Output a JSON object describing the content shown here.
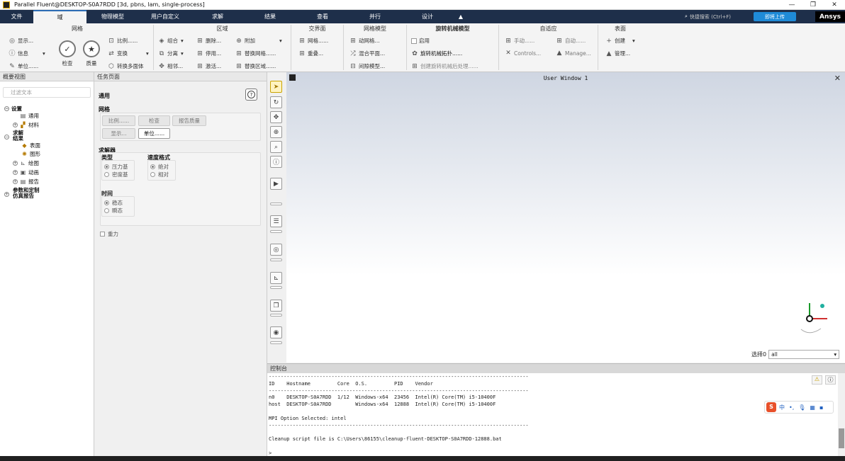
{
  "titlebar": {
    "title": "Parallel Fluent@DESKTOP-S0A7RDD  [3d, pbns, lam, single-process]",
    "min": "—",
    "restore": "❐",
    "close": "✕"
  },
  "menu": {
    "items": [
      "文件",
      "域",
      "物理模型",
      "用户自定义",
      "求解",
      "结果",
      "查看",
      "并行",
      "设计",
      "▲"
    ],
    "search": "快捷搜索 (Ctrl+F)",
    "upload": "即将上传",
    "brand": "Ansys"
  },
  "ribbon": {
    "mesh": {
      "title": "网格",
      "display": "显示...",
      "info": "信息",
      "units": "单位......",
      "scale": "比例......",
      "transform": "变换",
      "poly": "转换多面体",
      "check": "检查",
      "quality": "质量"
    },
    "zones": {
      "title": "区域",
      "combine": "组合",
      "separate": "分离",
      "adjacency": "相邻...",
      "delete": "删除...",
      "deactivate": "停用...",
      "activate": "激活...",
      "append": "附加",
      "replace_mesh": "替换网格......",
      "replace_zone": "替换区域......"
    },
    "interfaces": {
      "title": "交界面",
      "mesh": "网格......",
      "overset": "重叠..."
    },
    "mesh_models": {
      "title": "网格模型",
      "dynamic": "动网格...",
      "mixing": "混合平面...",
      "adaption": "间隙模型..."
    },
    "turbo": {
      "title": "旋转机械模型",
      "enable": "启用",
      "topology": "旋转机械拓扑......",
      "post": "创建旋转机械后处理......"
    },
    "adapt": {
      "title": "自适应",
      "manual": "手动......",
      "auto": "自动......",
      "controls": "Controls...",
      "manage": "Manage..."
    },
    "surface": {
      "title": "表面",
      "create": "创建",
      "manage": "管理..."
    }
  },
  "tree": {
    "title": "概要视图",
    "filter_placeholder": "过滤文本",
    "items": [
      {
        "label": "设置",
        "bold": true
      },
      {
        "label": "通用"
      },
      {
        "label": "材料"
      },
      {
        "label": "求解",
        "bold": true
      },
      {
        "label": "结果",
        "bold": true
      },
      {
        "label": "表面"
      },
      {
        "label": "图形"
      },
      {
        "label": "绘图"
      },
      {
        "label": "动画"
      },
      {
        "label": "报告"
      },
      {
        "label": "参数和定制",
        "bold": true
      },
      {
        "label": "仿真报告",
        "bold": true
      }
    ]
  },
  "task": {
    "title": "任务页面",
    "heading": "通用",
    "help": "?",
    "mesh_label": "网格",
    "mesh_buttons": {
      "scale": "比例......",
      "check": "检查",
      "report_quality": "报告质量",
      "display": "显示...",
      "units": "单位......"
    },
    "solver_label": "求解器",
    "type_label": "类型",
    "type_options": [
      "压力基",
      "密度基"
    ],
    "velocity_label": "速度格式",
    "velocity_options": [
      "绝对",
      "相对"
    ],
    "time_label": "时间",
    "time_options": [
      "稳态",
      "瞬态"
    ],
    "gravity": "重力"
  },
  "viewer": {
    "title": "User Window 1",
    "close": "✕",
    "select_label": "选择0",
    "select_value": "all"
  },
  "console": {
    "title": "控制台",
    "text": "---------------------------------------------------------------------------------------\nID    Hostname         Core  O.S.         PID    Vendor\n---------------------------------------------------------------------------------------\nn0    DESKTOP-S0A7RDD  1/12  Windows-x64  23456  Intel(R) Core(TM) i5-10400F\nhost  DESKTOP-S0A7RDD        Windows-x64  12888  Intel(R) Core(TM) i5-10400F\n\nMPI Option Selected: intel\n---------------------------------------------------------------------------------------\n\nCleanup script file is C:\\Users\\86155\\cleanup-fluent-DESKTOP-S0A7RDD-12888.bat\n\n>"
  },
  "ime": {
    "logo": "S",
    "lang": "中",
    "punct": "•,",
    "mic": "🎙",
    "kb": "▦",
    "grid": "▪"
  },
  "colors": {
    "menubar": "#1e2f4a",
    "accent": "#2d6db5",
    "upload": "#1f8bd8",
    "ime": "#e8502a"
  }
}
